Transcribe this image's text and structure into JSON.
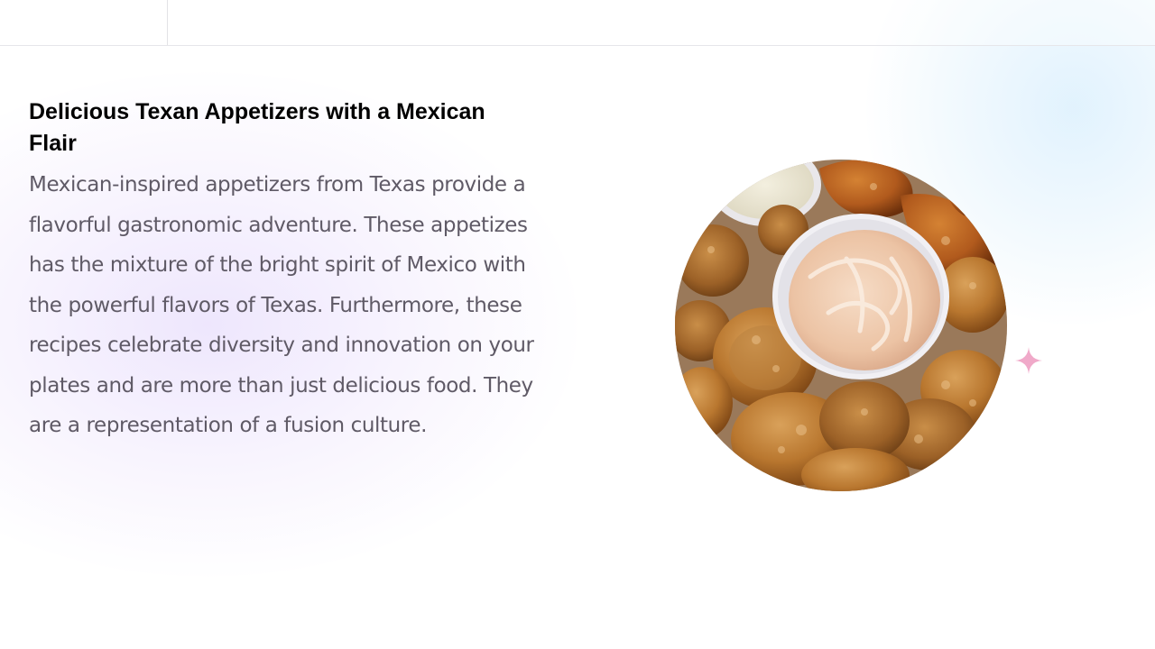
{
  "slide": {
    "title": "Delicious Texan Appetizers with a Mexican Flair",
    "body": "Mexican-inspired appetizers from Texas provide a flavorful gastronomic adventure. These appetizes has the mixture of the bright spirit of Mexico with the powerful flavors of Texas. Furthermore, these recipes celebrate diversity and innovation on your plates and are more than just delicious food. They are a representation of a fusion culture."
  },
  "image": {
    "subject": "plate of fried pickles, hush puppies and fried chicken bites with a cup of creamy dipping sauce"
  },
  "decorations": {
    "sparkle_icon": "four-point-star",
    "sparkle_color": "#f0a9c9",
    "left_glow_color": "#e8defc",
    "right_glow_color": "#dcf0fd"
  },
  "colors": {
    "title": "#000000",
    "body": "#5f5a66"
  }
}
